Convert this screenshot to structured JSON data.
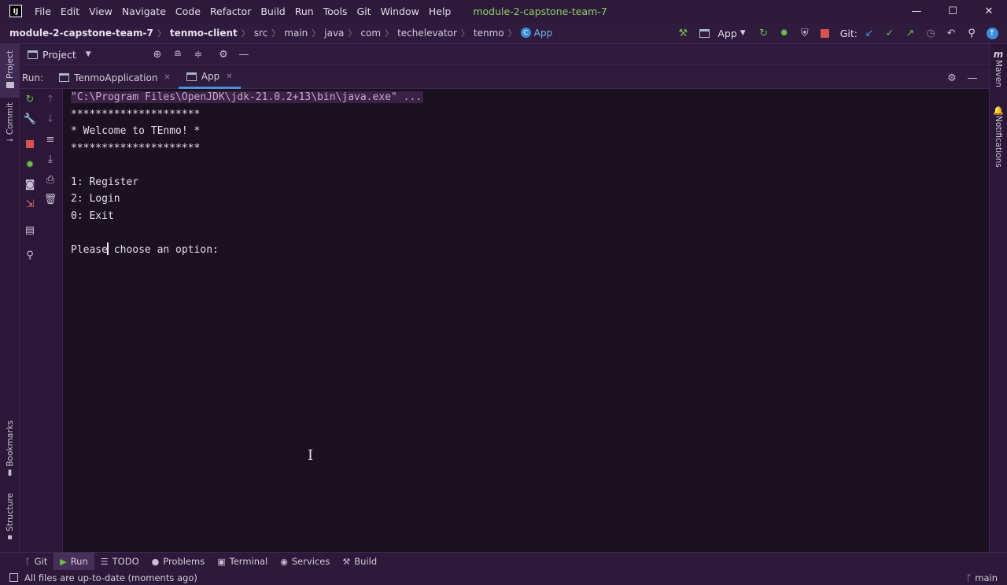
{
  "app": {
    "logo_letter": "IJ",
    "menu": [
      "File",
      "Edit",
      "View",
      "Navigate",
      "Code",
      "Refactor",
      "Build",
      "Run",
      "Tools",
      "Git",
      "Window",
      "Help"
    ],
    "project_title": "module-2-capstone-team-7",
    "accent_color": "#4a90d9",
    "project_title_color": "#8fcf6b"
  },
  "window_controls": {
    "minimize": "—",
    "maximize": "☐",
    "close": "✕"
  },
  "breadcrumb": [
    "module-2-capstone-team-7",
    "tenmo-client",
    "src",
    "main",
    "java",
    "com",
    "techelevator",
    "tenmo",
    "App"
  ],
  "toolbar": {
    "run_config": "App",
    "git_label": "Git:"
  },
  "project_panel": {
    "label": "Project"
  },
  "run_panel": {
    "label": "Run:",
    "tabs": [
      {
        "label": "TenmoApplication",
        "active": false
      },
      {
        "label": "App",
        "active": true
      }
    ]
  },
  "console": {
    "command": "\"C:\\Program Files\\OpenJDK\\jdk-21.0.2+13\\bin\\java.exe\" ...",
    "lines": [
      "*********************",
      "* Welcome to TEnmo! *",
      "*********************",
      "",
      "1: Register",
      "2: Login",
      "0: Exit",
      ""
    ],
    "prompt_before_cursor": "Please",
    "prompt_after_cursor": " choose an option:"
  },
  "left_stripe": {
    "project": "Project",
    "commit": "Commit",
    "bookmarks": "Bookmarks",
    "structure": "Structure"
  },
  "right_stripe": {
    "maven": "Maven",
    "notifications": "Notifications"
  },
  "bottom_tabs": [
    {
      "label": "Git",
      "icon": "git-branch-icon"
    },
    {
      "label": "Run",
      "icon": "play-icon",
      "active": true
    },
    {
      "label": "TODO",
      "icon": "list-icon"
    },
    {
      "label": "Problems",
      "icon": "info-icon"
    },
    {
      "label": "Terminal",
      "icon": "terminal-icon"
    },
    {
      "label": "Services",
      "icon": "services-icon"
    },
    {
      "label": "Build",
      "icon": "hammer-icon"
    }
  ],
  "status": {
    "message": "All files are up-to-date (moments ago)",
    "branch": "main"
  }
}
